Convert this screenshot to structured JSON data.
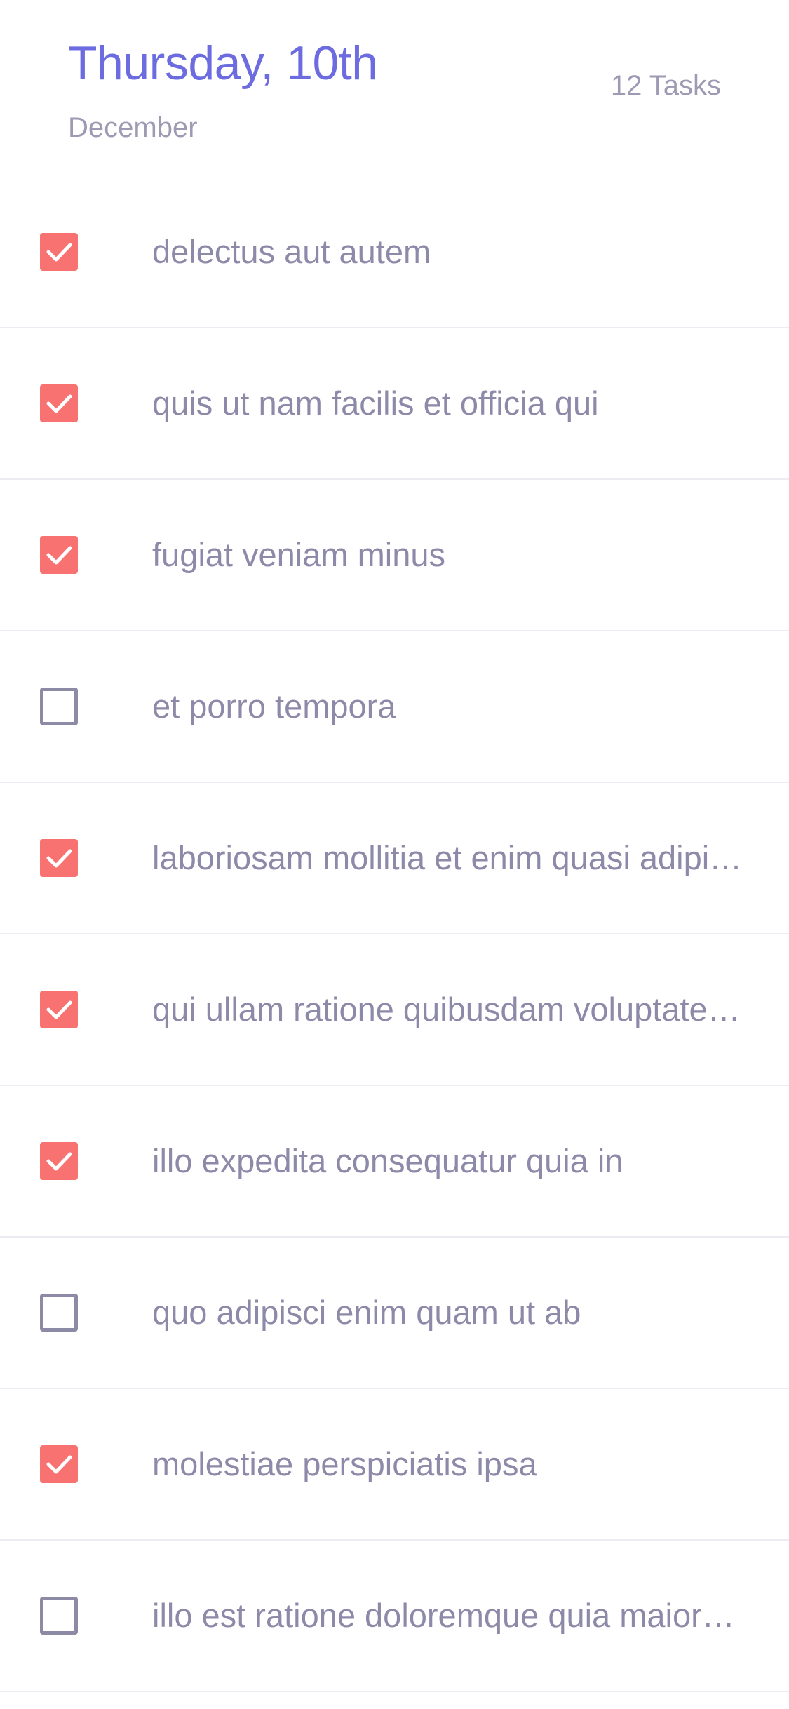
{
  "header": {
    "title": "Thursday, 10th",
    "subtitle": "December",
    "task_count": "12 Tasks"
  },
  "colors": {
    "accent": "#6C6CE0",
    "checked": "#F87272",
    "muted_text": "#9E9AB3",
    "divider": "#EDECF3"
  },
  "tasks": [
    {
      "label": "delectus aut autem",
      "done": true
    },
    {
      "label": "quis ut nam facilis et officia qui",
      "done": true
    },
    {
      "label": "fugiat veniam minus",
      "done": true
    },
    {
      "label": "et porro tempora",
      "done": false
    },
    {
      "label": "laboriosam mollitia et enim quasi adipisci quia provident illum",
      "done": true
    },
    {
      "label": "qui ullam ratione quibusdam voluptatem quia omnis",
      "done": true
    },
    {
      "label": "illo expedita consequatur quia in",
      "done": true
    },
    {
      "label": "quo adipisci enim quam ut ab",
      "done": false
    },
    {
      "label": "molestiae perspiciatis ipsa",
      "done": true
    },
    {
      "label": "illo est ratione doloremque quia maiores aut",
      "done": false
    },
    {
      "label": "",
      "done": false
    }
  ]
}
